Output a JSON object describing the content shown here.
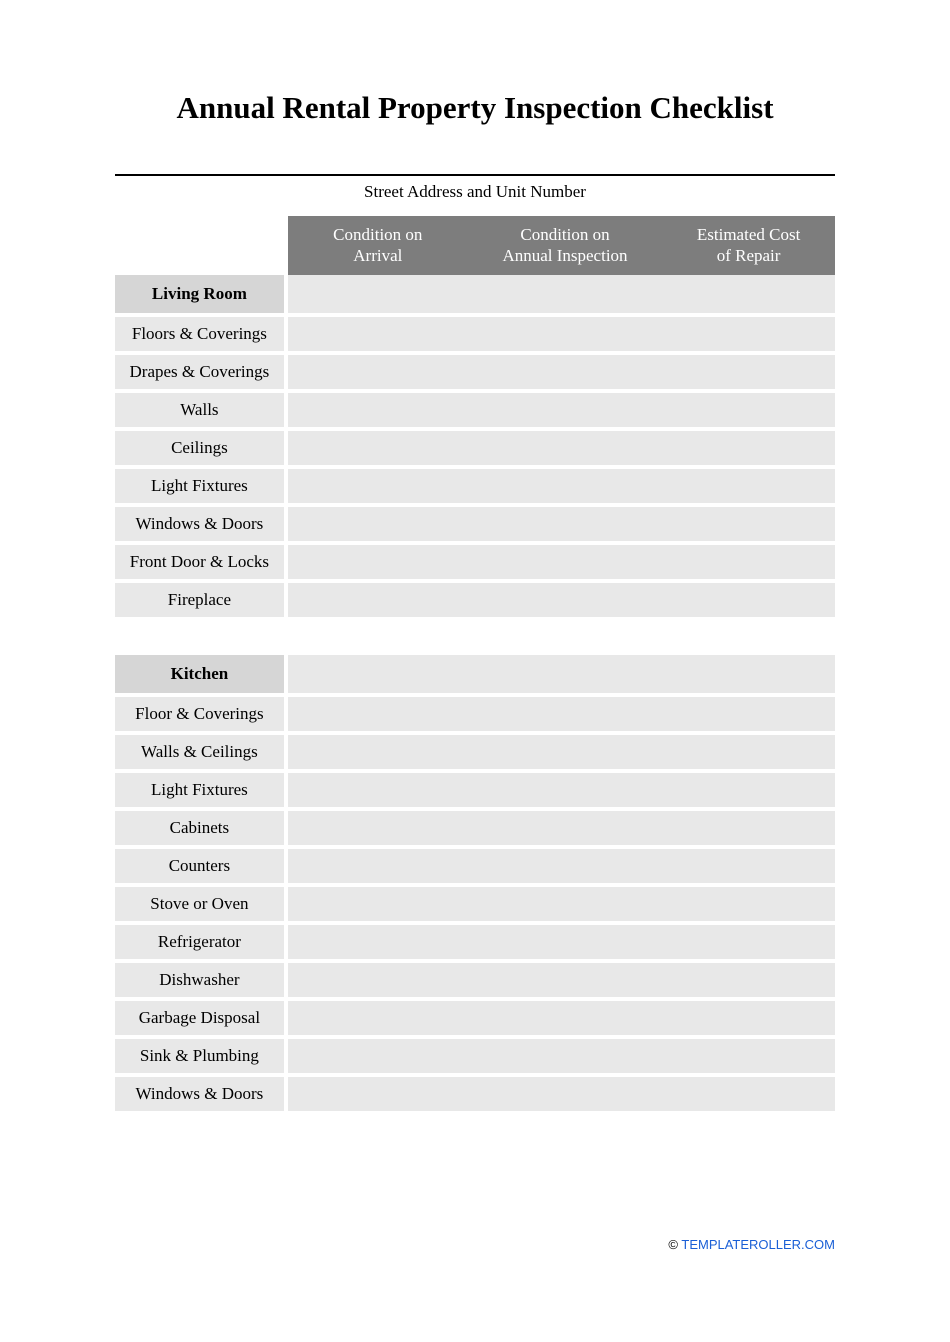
{
  "title": "Annual Rental Property Inspection Checklist",
  "address_caption": "Street Address and Unit Number",
  "columns": {
    "label": "",
    "arrival": "Condition on\nArrival",
    "annual": "Condition on\nAnnual Inspection",
    "cost": "Estimated Cost\nof Repair"
  },
  "sections": [
    {
      "name": "Living Room",
      "items": [
        "Floors & Coverings",
        "Drapes & Coverings",
        "Walls",
        "Ceilings",
        "Light Fixtures",
        "Windows & Doors",
        "Front Door & Locks",
        "Fireplace"
      ]
    },
    {
      "name": "Kitchen",
      "items": [
        "Floor & Coverings",
        "Walls & Ceilings",
        "Light Fixtures",
        "Cabinets",
        "Counters",
        "Stove or Oven",
        "Refrigerator",
        "Dishwasher",
        "Garbage Disposal",
        "Sink & Plumbing",
        "Windows & Doors"
      ]
    }
  ],
  "footer": {
    "copyright": "©",
    "link_text": "TEMPLATEROLLER.COM"
  }
}
